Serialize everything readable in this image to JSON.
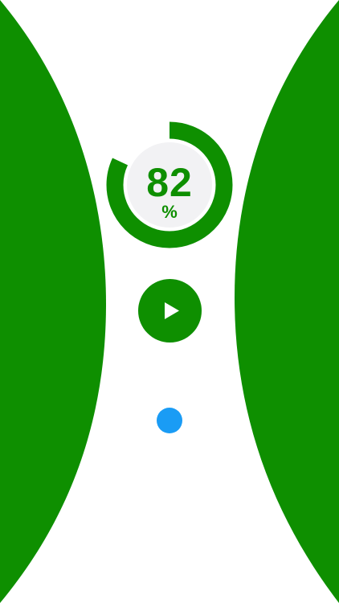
{
  "colors": {
    "background": "#ffffff",
    "wall_green": "#0e8f00",
    "ring_green": "#0e8f00",
    "ring_inner": "#f2f2f4",
    "text_green": "#0e8f00",
    "play_button_bg": "#0e8f00",
    "play_icon": "#ffffff",
    "player_dot": "#1a9cf5"
  },
  "progress": {
    "value": 82,
    "value_text": "82",
    "unit": "%"
  },
  "controls": {
    "play_icon_name": "play-icon"
  },
  "player": {
    "icon_name": "dot-icon"
  }
}
